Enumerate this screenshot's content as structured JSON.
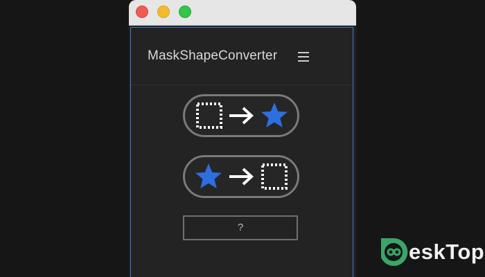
{
  "window": {
    "controls": [
      "close",
      "minimize",
      "zoom"
    ]
  },
  "panel": {
    "title": "MaskShapeConverter",
    "menu_icon": "hamburger-menu-icon"
  },
  "buttons": [
    {
      "icons": [
        "mask-outline-icon",
        "arrow-right-icon",
        "star-shape-icon"
      ]
    },
    {
      "icons": [
        "star-shape-icon",
        "arrow-right-icon",
        "mask-outline-icon"
      ]
    }
  ],
  "help": {
    "label": "?"
  },
  "colors": {
    "star": "#2e6fe0",
    "panel_border": "#3f78c4",
    "close": "#ee5b52",
    "minimize": "#f2bb2e",
    "zoom": "#35c547"
  },
  "watermark": {
    "text": "eskTop",
    "logo": "d-logo"
  }
}
